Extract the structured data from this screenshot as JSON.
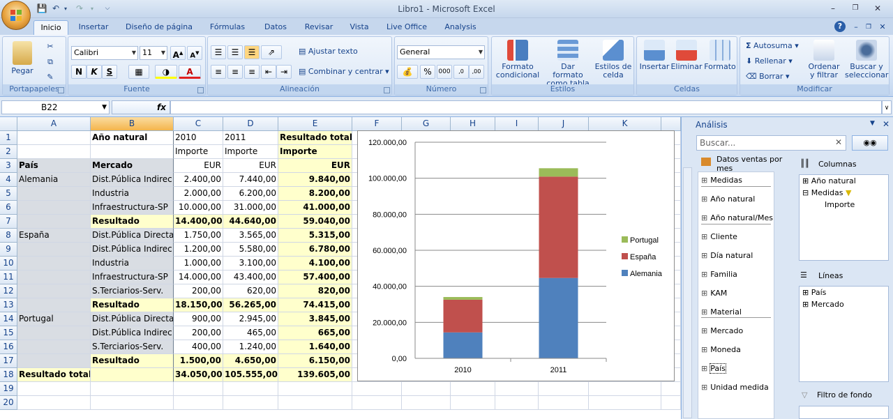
{
  "window": {
    "title": "Libro1 - Microsoft Excel"
  },
  "tabs": [
    "Inicio",
    "Insertar",
    "Diseño de página",
    "Fórmulas",
    "Datos",
    "Revisar",
    "Vista",
    "Live Office",
    "Analysis"
  ],
  "ribbon": {
    "portapapeles": {
      "label": "Portapapeles",
      "pegar": "Pegar"
    },
    "fuente": {
      "label": "Fuente",
      "font": "Calibri",
      "size": "11"
    },
    "alineacion": {
      "label": "Alineación",
      "ajustar": "Ajustar texto",
      "combinar": "Combinar y centrar"
    },
    "numero": {
      "label": "Número",
      "format": "General"
    },
    "estilos": {
      "label": "Estilos",
      "formato_condicional": "Formato condicional",
      "dar_formato": "Dar formato como tabla",
      "estilos_celda": "Estilos de celda"
    },
    "celdas": {
      "label": "Celdas",
      "insertar": "Insertar",
      "eliminar": "Eliminar",
      "formato": "Formato"
    },
    "modificar": {
      "label": "Modificar",
      "autosuma": "Autosuma",
      "rellenar": "Rellenar",
      "borrar": "Borrar",
      "ordenar": "Ordenar y filtrar",
      "buscar": "Buscar y seleccionar"
    }
  },
  "formula": {
    "namebox": "B22",
    "fx": "fx",
    "value": ""
  },
  "columns": [
    "A",
    "B",
    "C",
    "D",
    "E",
    "F",
    "G",
    "H",
    "I",
    "J",
    "K"
  ],
  "rows": [
    "1",
    "2",
    "3",
    "4",
    "5",
    "6",
    "7",
    "8",
    "9",
    "10",
    "11",
    "12",
    "13",
    "14",
    "15",
    "16",
    "17",
    "18",
    "19",
    "20"
  ],
  "table": [
    [
      "",
      "Año natural",
      "2010",
      "2011",
      "Resultado total"
    ],
    [
      "",
      "",
      "Importe",
      "Importe",
      "Importe"
    ],
    [
      "País",
      "Mercado",
      "EUR",
      "EUR",
      "EUR"
    ],
    [
      "Alemania",
      "Dist.Pública Indirec",
      "2.400,00",
      "7.440,00",
      "9.840,00"
    ],
    [
      "",
      "Industria",
      "2.000,00",
      "6.200,00",
      "8.200,00"
    ],
    [
      "",
      "Infraestructura-SP",
      "10.000,00",
      "31.000,00",
      "41.000,00"
    ],
    [
      "",
      "Resultado",
      "14.400,00",
      "44.640,00",
      "59.040,00"
    ],
    [
      "España",
      "Dist.Pública Directa",
      "1.750,00",
      "3.565,00",
      "5.315,00"
    ],
    [
      "",
      "Dist.Pública Indirec",
      "1.200,00",
      "5.580,00",
      "6.780,00"
    ],
    [
      "",
      "Industria",
      "1.000,00",
      "3.100,00",
      "4.100,00"
    ],
    [
      "",
      "Infraestructura-SP",
      "14.000,00",
      "43.400,00",
      "57.400,00"
    ],
    [
      "",
      "S.Terciarios-Serv.",
      "200,00",
      "620,00",
      "820,00"
    ],
    [
      "",
      "Resultado",
      "18.150,00",
      "56.265,00",
      "74.415,00"
    ],
    [
      "Portugal",
      "Dist.Pública Directa",
      "900,00",
      "2.945,00",
      "3.845,00"
    ],
    [
      "",
      "Dist.Pública Indirec",
      "200,00",
      "465,00",
      "665,00"
    ],
    [
      "",
      "S.Terciarios-Serv.",
      "400,00",
      "1.240,00",
      "1.640,00"
    ],
    [
      "",
      "Resultado",
      "1.500,00",
      "4.650,00",
      "6.150,00"
    ],
    [
      "Resultado total",
      "",
      "34.050,00",
      "105.555,00",
      "139.605,00"
    ]
  ],
  "chart_data": {
    "type": "bar",
    "stacked": true,
    "categories": [
      "2010",
      "2011"
    ],
    "series": [
      {
        "name": "Alemania",
        "values": [
          14400,
          44640
        ],
        "color": "#4f81bd"
      },
      {
        "name": "España",
        "values": [
          18150,
          56265
        ],
        "color": "#c0504d"
      },
      {
        "name": "Portugal",
        "values": [
          1500,
          4650
        ],
        "color": "#9bbb59"
      }
    ],
    "ylim": [
      0,
      120000
    ],
    "yticks": [
      "0,00",
      "20.000,00",
      "40.000,00",
      "60.000,00",
      "80.000,00",
      "100.000,00",
      "120.000,00"
    ],
    "legend": "right",
    "grid": true
  },
  "panel": {
    "title": "Análisis",
    "search_placeholder": "Buscar...",
    "source": "Datos ventas por mes",
    "fields": [
      "Medidas",
      "Año natural",
      "Año natural/Mes",
      "Cliente",
      "Día natural",
      "Familia",
      "KAM",
      "Material",
      "Mercado",
      "Moneda",
      "País",
      "Unidad medida"
    ],
    "columnas_label": "Columnas",
    "columnas": [
      "Año natural",
      "Medidas",
      "Importe"
    ],
    "lineas_label": "Líneas",
    "lineas": [
      "País",
      "Mercado"
    ],
    "filtro_label": "Filtro de fondo"
  }
}
